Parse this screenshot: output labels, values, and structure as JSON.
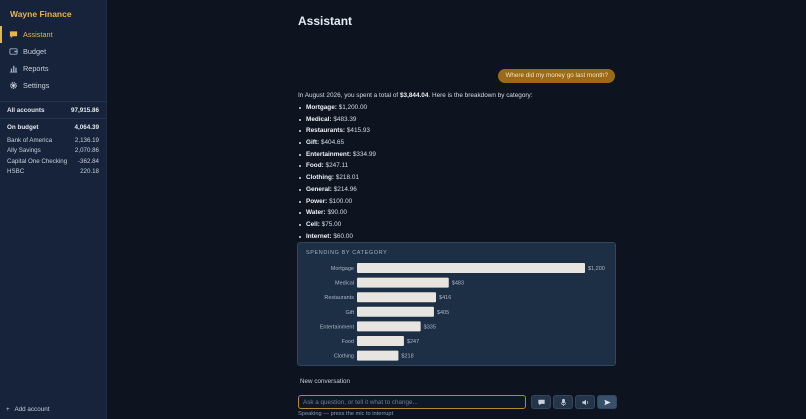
{
  "app": {
    "brand": "Wayne Finance"
  },
  "nav": [
    {
      "label": "Assistant",
      "icon": "chat-icon",
      "active": true
    },
    {
      "label": "Budget",
      "icon": "wallet-icon",
      "active": false
    },
    {
      "label": "Reports",
      "icon": "bar-chart-icon",
      "active": false
    },
    {
      "label": "Settings",
      "icon": "gear-icon",
      "active": false
    }
  ],
  "accounts": {
    "all_label": "All accounts",
    "all_value": "97,915.86",
    "budget_label": "On budget",
    "budget_value": "4,064.39",
    "list": [
      {
        "name": "Bank of America",
        "value": "2,136.19"
      },
      {
        "name": "Ally Savings",
        "value": "2,070.86"
      },
      {
        "name": "Capital One Checking",
        "value": "-362.84"
      },
      {
        "name": "HSBC",
        "value": "220.18"
      }
    ],
    "add_label": "Add account"
  },
  "main": {
    "title": "Assistant",
    "user_message": "Where did my money go last month?",
    "answer_prefix": "In August 2026, you spent a total of ",
    "answer_total": "$3,844.04",
    "answer_suffix": ". Here is the breakdown by category:",
    "breakdown": [
      {
        "category": "Mortgage:",
        "amount": "$1,200.00"
      },
      {
        "category": "Medical:",
        "amount": "$483.39"
      },
      {
        "category": "Restaurants:",
        "amount": "$415.93"
      },
      {
        "category": "Gift:",
        "amount": "$404.65"
      },
      {
        "category": "Entertainment:",
        "amount": "$334.99"
      },
      {
        "category": "Food:",
        "amount": "$247.11"
      },
      {
        "category": "Clothing:",
        "amount": "$218.01"
      },
      {
        "category": "General:",
        "amount": "$214.96"
      },
      {
        "category": "Power:",
        "amount": "$100.00"
      },
      {
        "category": "Water:",
        "amount": "$90.00"
      },
      {
        "category": "Cell:",
        "amount": "$75.00"
      },
      {
        "category": "Internet:",
        "amount": "$60.00"
      }
    ],
    "new_conversation": "New conversation",
    "input_placeholder": "Ask a question, or tell it what to change...",
    "hint": "Speaking — press the mic to interrupt"
  },
  "chart_data": {
    "type": "bar",
    "orientation": "horizontal",
    "title": "SPENDING BY CATEGORY",
    "categories": [
      "Mortgage",
      "Medical",
      "Restaurants",
      "Gift",
      "Entertainment",
      "Food",
      "Clothing"
    ],
    "values": [
      1200,
      483,
      416,
      405,
      335,
      247,
      218
    ],
    "value_labels": [
      "$1,200",
      "$483",
      "$416",
      "$405",
      "$335",
      "$247",
      "$218"
    ],
    "bar_color": "#e8e4df"
  },
  "colors": {
    "accent": "#e8b54a",
    "background": "#0d1420",
    "sidebar": "#16233a",
    "bubble": "#9a6a18"
  }
}
